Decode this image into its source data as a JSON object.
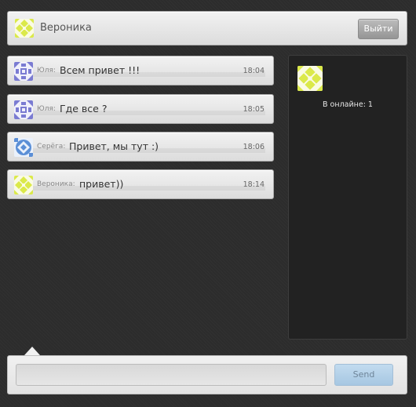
{
  "header": {
    "username": "Вероника",
    "logout_label": "Выйти"
  },
  "messages": [
    {
      "author": "Юля:",
      "text": "Всем привет !!!",
      "time": "18:04",
      "avatar": "identicon-purple"
    },
    {
      "author": "Юля:",
      "text": "Где все ?",
      "time": "18:05",
      "avatar": "identicon-purple"
    },
    {
      "author": "Серёга:",
      "text": "Привет, мы тут :)",
      "time": "18:06",
      "avatar": "identicon-blue"
    },
    {
      "author": "Вероника:",
      "text": "привет))",
      "time": "18:14",
      "avatar": "identicon-yellow"
    }
  ],
  "online": {
    "count_label": "В онлайне: 1",
    "users": [
      {
        "avatar": "identicon-yellow"
      }
    ]
  },
  "composer": {
    "input_value": "",
    "input_placeholder": "",
    "send_label": "Send"
  },
  "colors": {
    "background": "#2c2c2c",
    "identicon_purple": "#7a7bd2",
    "identicon_blue": "#5b8fd6",
    "identicon_yellow": "#dbe94a",
    "send_button": "#b3d1ea"
  }
}
